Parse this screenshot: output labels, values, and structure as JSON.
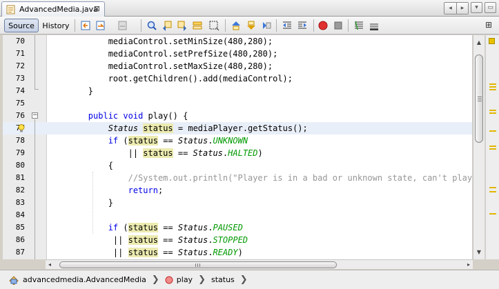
{
  "tab": {
    "title": "AdvancedMedia.java",
    "close": "⊠"
  },
  "window": {
    "left": "◂",
    "right": "▸",
    "menu": "▾",
    "maximize": "▭"
  },
  "toolbar": {
    "source_label": "Source",
    "history_label": "History",
    "expand": "⊞"
  },
  "code_lines": [
    {
      "num": "70",
      "parts": [
        [
          "",
          "            mediaControl.setMinSize(480,280);"
        ]
      ]
    },
    {
      "num": "71",
      "parts": [
        [
          "",
          "            mediaControl.setPrefSize(480,280);"
        ]
      ]
    },
    {
      "num": "72",
      "parts": [
        [
          "",
          "            mediaControl.setMaxSize(480,280);"
        ]
      ]
    },
    {
      "num": "73",
      "parts": [
        [
          "",
          "            root.getChildren().add(mediaControl);"
        ]
      ]
    },
    {
      "num": "74",
      "parts": [
        [
          "",
          "        }"
        ]
      ]
    },
    {
      "num": "75",
      "parts": [
        [
          "",
          ""
        ]
      ]
    },
    {
      "num": "76",
      "parts": [
        [
          "",
          "        "
        ],
        [
          "kw",
          "public"
        ],
        [
          "",
          " "
        ],
        [
          "kw",
          "void"
        ],
        [
          "",
          " play() {"
        ]
      ]
    },
    {
      "num": "77",
      "parts": [
        [
          "",
          "            "
        ],
        [
          "it",
          "Status"
        ],
        [
          "",
          " "
        ],
        [
          "var",
          "status"
        ],
        [
          "",
          " = "
        ],
        [
          "kwm",
          "mediaPlayer"
        ],
        [
          "",
          ".getStatus();"
        ]
      ]
    },
    {
      "num": "78",
      "parts": [
        [
          "",
          "            "
        ],
        [
          "kw",
          "if"
        ],
        [
          "",
          " ("
        ],
        [
          "var",
          "status"
        ],
        [
          "",
          " == "
        ],
        [
          "it",
          "Status"
        ],
        [
          "",
          "."
        ],
        [
          "const",
          "UNKNOWN"
        ]
      ]
    },
    {
      "num": "79",
      "parts": [
        [
          "",
          "                || "
        ],
        [
          "var",
          "status"
        ],
        [
          "",
          " == "
        ],
        [
          "it",
          "Status"
        ],
        [
          "",
          "."
        ],
        [
          "const",
          "HALTED"
        ],
        [
          "",
          ")"
        ]
      ]
    },
    {
      "num": "80",
      "parts": [
        [
          "",
          "            {"
        ]
      ]
    },
    {
      "num": "81",
      "parts": [
        [
          "",
          "                "
        ],
        [
          "cm",
          "//System.out.println(\"Player is in a bad or unknown state, can't play.\");"
        ]
      ]
    },
    {
      "num": "82",
      "parts": [
        [
          "",
          "                "
        ],
        [
          "kw",
          "return"
        ],
        [
          "",
          ";"
        ]
      ]
    },
    {
      "num": "83",
      "parts": [
        [
          "",
          "            }"
        ]
      ]
    },
    {
      "num": "84",
      "parts": [
        [
          "",
          ""
        ]
      ]
    },
    {
      "num": "85",
      "parts": [
        [
          "",
          "            "
        ],
        [
          "kw",
          "if"
        ],
        [
          "",
          " ("
        ],
        [
          "var",
          "status"
        ],
        [
          "",
          " == "
        ],
        [
          "it",
          "Status"
        ],
        [
          "",
          "."
        ],
        [
          "const",
          "PAUSED"
        ]
      ]
    },
    {
      "num": "86",
      "parts": [
        [
          "",
          "             || "
        ],
        [
          "var",
          "status"
        ],
        [
          "",
          " == "
        ],
        [
          "it",
          "Status"
        ],
        [
          "",
          "."
        ],
        [
          "const",
          "STOPPED"
        ]
      ]
    },
    {
      "num": "87",
      "parts": [
        [
          "",
          "             || "
        ],
        [
          "var",
          "status"
        ],
        [
          "",
          " == "
        ],
        [
          "it",
          "Status"
        ],
        [
          "",
          "."
        ],
        [
          "const",
          "READY"
        ],
        [
          "",
          ")"
        ]
      ]
    }
  ],
  "current_line": "77",
  "fold_marker": "−",
  "scrollbar": {
    "up": "▲",
    "down": "▼",
    "left": "◂",
    "right": "▸",
    "grip": "|||"
  },
  "breadcrumb": {
    "items": [
      {
        "label": "advancedmedia.AdvancedMedia",
        "icon": "class-icon"
      },
      {
        "label": "play",
        "icon": "method-icon"
      },
      {
        "label": "status",
        "icon": "variable"
      }
    ],
    "separator": "❯"
  },
  "colors": {
    "keyword": "#0000e6",
    "constant": "#009900",
    "comment": "#969696",
    "highlight": "#ecebb0",
    "current_line": "#e9eff8"
  }
}
